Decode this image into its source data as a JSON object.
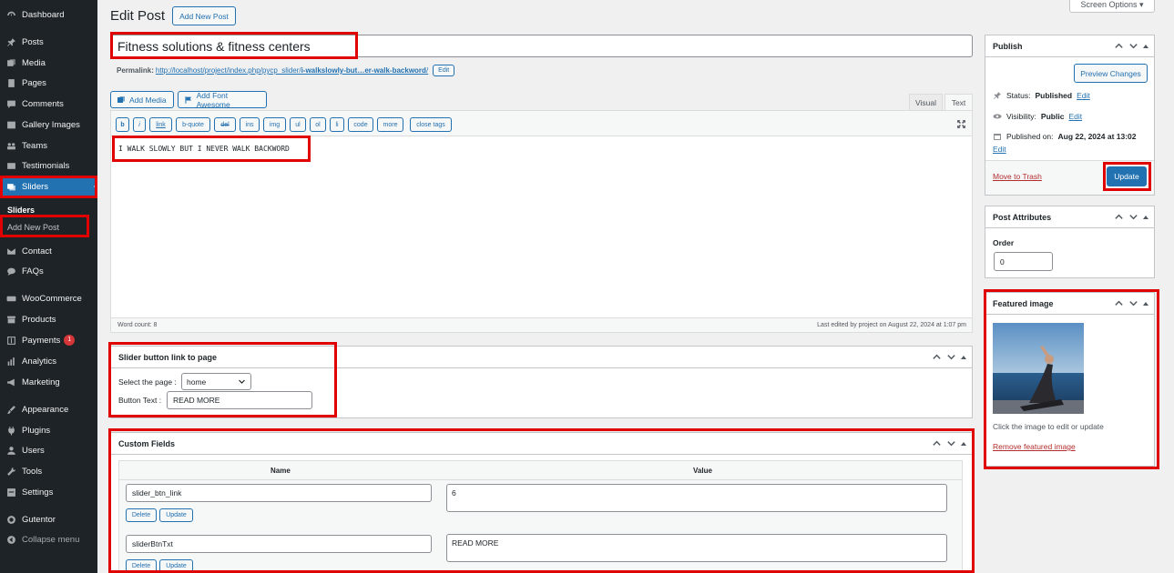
{
  "sidebar": {
    "items": [
      {
        "label": "Dashboard",
        "icon": "dashboard-icon"
      },
      {
        "label": "Posts",
        "icon": "pin-icon"
      },
      {
        "label": "Media",
        "icon": "media-icon"
      },
      {
        "label": "Pages",
        "icon": "pages-icon"
      },
      {
        "label": "Comments",
        "icon": "comments-icon"
      },
      {
        "label": "Gallery Images",
        "icon": "gallery-icon"
      },
      {
        "label": "Teams",
        "icon": "teams-icon"
      },
      {
        "label": "Testimonials",
        "icon": "testimonials-icon"
      },
      {
        "label": "Sliders",
        "icon": "sliders-icon"
      },
      {
        "label": "Contact",
        "icon": "mail-icon"
      },
      {
        "label": "FAQs",
        "icon": "chat-icon"
      },
      {
        "label": "WooCommerce",
        "icon": "woo-icon"
      },
      {
        "label": "Products",
        "icon": "archive-icon"
      },
      {
        "label": "Payments",
        "icon": "dollar-icon",
        "badge": "1"
      },
      {
        "label": "Analytics",
        "icon": "bar-chart-icon"
      },
      {
        "label": "Marketing",
        "icon": "megaphone-icon"
      },
      {
        "label": "Appearance",
        "icon": "brush-icon"
      },
      {
        "label": "Plugins",
        "icon": "plug-icon"
      },
      {
        "label": "Users",
        "icon": "users-icon"
      },
      {
        "label": "Tools",
        "icon": "wrench-icon"
      },
      {
        "label": "Settings",
        "icon": "settings-icon"
      },
      {
        "label": "Gutentor",
        "icon": "gutentor-icon"
      },
      {
        "label": "Collapse menu",
        "icon": "collapse-icon"
      }
    ],
    "submenu_head": "Sliders",
    "submenu_item": "Add New Post"
  },
  "header": {
    "title": "Edit Post",
    "add_new": "Add New Post",
    "screen_options": "Screen Options"
  },
  "post": {
    "title": "Fitness solutions & fitness centers",
    "permalink_label": "Permalink:",
    "permalink_base": "http://localhost/project/index.php/pycp_slider/",
    "permalink_slug": "i-walkslowly-but…er-walk-backword",
    "permalink_tail": "/",
    "permalink_edit": "Edit"
  },
  "editor": {
    "add_media": "Add Media",
    "add_font": "Add Font Awesome",
    "tab_visual": "Visual",
    "tab_text": "Text",
    "quicktags": [
      "b",
      "i",
      "link",
      "b-quote",
      "del",
      "ins",
      "img",
      "ul",
      "ol",
      "li",
      "code",
      "more",
      "close tags"
    ],
    "content": "I WALK SLOWLY BUT I NEVER WALK BACKWORD",
    "word_count": "Word count: 8",
    "last_edited": "Last edited by project on August 22, 2024 at 1:07 pm"
  },
  "slider_box": {
    "title": "Slider button link to page",
    "select_label": "Select the page :",
    "select_value": "home",
    "button_text_label": "Button Text :",
    "button_text_value": "READ MORE"
  },
  "custom_fields": {
    "title": "Custom Fields",
    "col_name": "Name",
    "col_value": "Value",
    "rows": [
      {
        "name": "slider_btn_link",
        "value": "6",
        "delete": "Delete",
        "update": "Update"
      },
      {
        "name": "sliderBtnTxt",
        "value": "READ MORE",
        "delete": "Delete",
        "update": "Update"
      }
    ]
  },
  "publish": {
    "title": "Publish",
    "preview": "Preview Changes",
    "status_label": "Status:",
    "status_value": "Published",
    "visibility_label": "Visibility:",
    "visibility_value": "Public",
    "published_label": "Published on:",
    "published_value": "Aug 22, 2024 at 13:02",
    "edit": "Edit",
    "trash": "Move to Trash",
    "update": "Update"
  },
  "attributes": {
    "title": "Post Attributes",
    "order_label": "Order",
    "order_value": "0"
  },
  "featured": {
    "title": "Featured image",
    "hint": "Click the image to edit or update",
    "remove": "Remove featured image"
  }
}
